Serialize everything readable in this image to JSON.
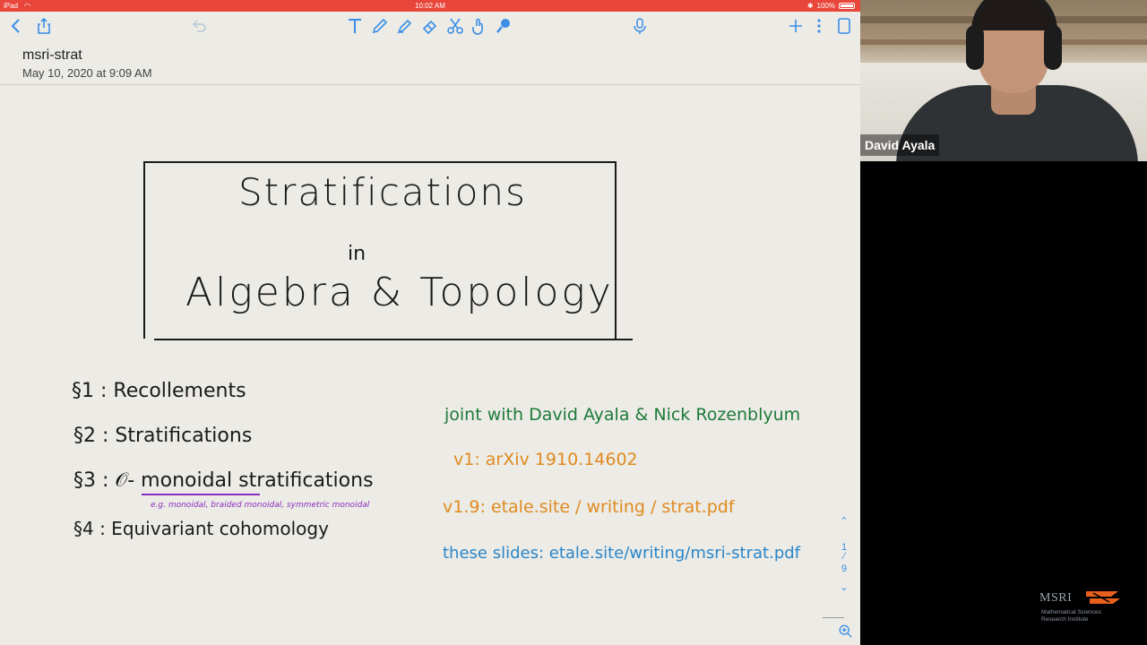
{
  "status_bar": {
    "device": "iPad",
    "time": "10:02 AM",
    "battery": "100%",
    "battery_level": 1.0
  },
  "toolbar": {
    "icons": [
      "back-chevron-icon",
      "share-icon",
      "undo-icon",
      "text-tool-icon",
      "pencil-icon",
      "highlighter-icon",
      "eraser-icon",
      "scissors-icon",
      "touch-icon",
      "lasso-icon",
      "microphone-icon",
      "add-icon",
      "more-icon",
      "page-icon"
    ]
  },
  "note": {
    "title": "msri-strat",
    "date": "May 10, 2020 at 9:09 AM"
  },
  "slide": {
    "title_line1": "Stratifications",
    "title_line2": "in",
    "title_line3": "Algebra & Topology",
    "sections": [
      "§1 :  Recollements",
      "§2 :  Stratifications",
      "§3 :  𝒪- monoidal  stratifications",
      "§4 :  Equivariant  cohomology"
    ],
    "section3_note": "e.g.  monoidal,  braided monoidal,  symmetric monoidal",
    "joint": "joint with David Ayala & Nick Rozenblyum",
    "v1": "v1:  arXiv  1910.14602",
    "v19": "v1.9:  etale.site / writing / strat.pdf",
    "slides": "these  slides:   etale.site/writing/msri-strat.pdf",
    "colors": {
      "ink": "#1a1a1a",
      "purple": "#8a2dbf",
      "green": "#1e7a3a",
      "orange": "#e08a1f",
      "blue": "#2a86c9"
    }
  },
  "page_nav": {
    "current": "1",
    "separator": "⁄",
    "total": "9"
  },
  "video": {
    "speaker_name": "David Ayala"
  },
  "logo": {
    "name": "MSRI",
    "subtitle_line1": "Mathematical Sciences",
    "subtitle_line2": "Research Institute"
  }
}
